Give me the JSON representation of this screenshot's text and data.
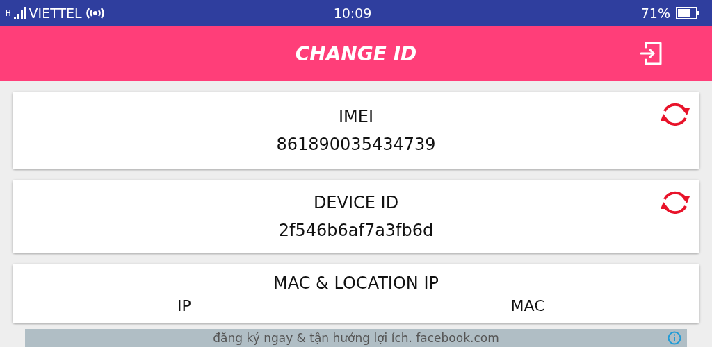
{
  "status_bar": {
    "network": "H",
    "carrier": "VIETTEL",
    "time": "10:09",
    "battery_percent": "71%",
    "battery": {
      "level": 0.71
    }
  },
  "header": {
    "title": "CHANGE ID"
  },
  "cards": [
    {
      "kind": "id",
      "title": "IMEI",
      "value": "861890035434739"
    },
    {
      "kind": "id",
      "title": "DEVICE ID",
      "value": "2f546b6af7a3fb6d"
    },
    {
      "kind": "columns",
      "title": "MAC & LOCATION IP",
      "columns": [
        "IP",
        "MAC"
      ]
    }
  ],
  "ad": {
    "text": "đăng ký ngay & tận hưởng lợi ích. facebook.com"
  }
}
